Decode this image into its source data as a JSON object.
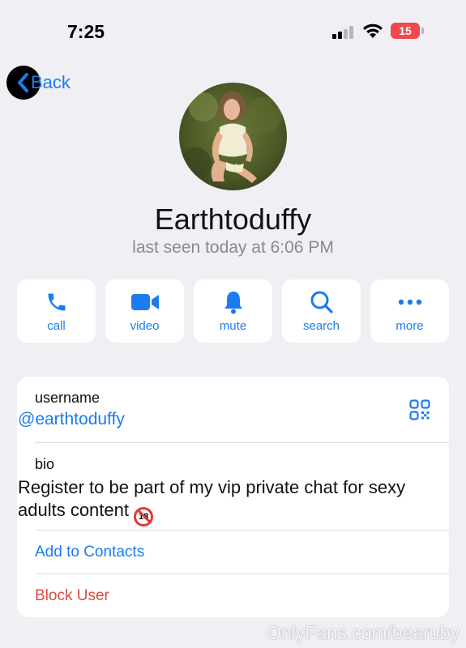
{
  "status_bar": {
    "time": "7:25",
    "battery": "15"
  },
  "nav": {
    "back_label": "Back"
  },
  "profile": {
    "name": "Earthtoduffy",
    "last_seen": "last seen today at 6:06 PM"
  },
  "actions": [
    {
      "label": "call",
      "icon": "phone-icon"
    },
    {
      "label": "video",
      "icon": "video-camera-icon"
    },
    {
      "label": "mute",
      "icon": "bell-icon"
    },
    {
      "label": "search",
      "icon": "magnifier-icon"
    },
    {
      "label": "more",
      "icon": "ellipsis-icon"
    }
  ],
  "info": {
    "username_label": "username",
    "username": "@earthtoduffy",
    "bio_label": "bio",
    "bio": "Register to be part of my vip private chat for sexy adults content",
    "add_contact": "Add to Contacts",
    "block_user": "Block User"
  },
  "watermark": "OnlyFans.com/bearuby",
  "colors": {
    "accent": "#1a7cf0",
    "danger": "#e0483e",
    "background": "#efeff4"
  }
}
